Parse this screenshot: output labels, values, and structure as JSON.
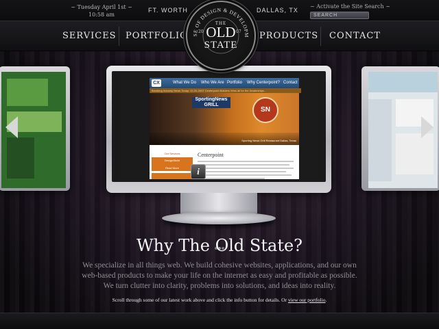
{
  "header": {
    "date_line1": "~ Tuesday April 1st ~",
    "date_line2": "10:58 am",
    "city_left": "FT. WORTH",
    "city_right": "DALLAS, TX",
    "search_label": "~ Activate the Site Search ~",
    "search_placeholder": "SEARCH"
  },
  "nav": {
    "services": "SERVICES",
    "portfolio": "PORTFOLIO",
    "products": "PRODUCTS",
    "contact": "CONTACT"
  },
  "logo": {
    "arc_text": "HOUSE OF DESIGN & DEVELOPMENT",
    "the": "THE",
    "old": "OLD",
    "state": "STATE",
    "year_left": "20",
    "year_right": "07"
  },
  "showcase": {
    "site_nav": [
      "What We Do",
      "Who We Are",
      "Portfolio",
      "Why Centerpoint?",
      "Contact"
    ],
    "site_logo": "CX",
    "ticker": "Breaking Industry News Today: 12-31-2007 Centerpoint Builders Wins all for the Dealerships...",
    "hero_sign": "SportingNews GRILL",
    "hero_badge": "SN",
    "hero_caption": "Sporting News Grill Restaurant Dallas, Texas",
    "side_title": "Our Services",
    "side_box_title": "Design/Build",
    "side_box_link": "Read More",
    "main_title": "Centerpoint",
    "info_label": "i"
  },
  "copy": {
    "headline": "Why The Old State?",
    "para_line1": "We specialize in all things web. We build cohesive websites, applications, and our own",
    "para_line2": "web-based products to make your life on the internet as easy and profitable as possible.",
    "para_line3": "We turn clutter into clarity, problems into solutions, and ideas into reality.",
    "note_text": "Scroll through some of our latest work above and click the info button for details. Or ",
    "note_link": "view our portfolio",
    "note_end": "."
  },
  "colors": {
    "background": "#0d0d0f",
    "accent_orange": "#d9741e",
    "site_nav_blue": "#2f5a87"
  }
}
